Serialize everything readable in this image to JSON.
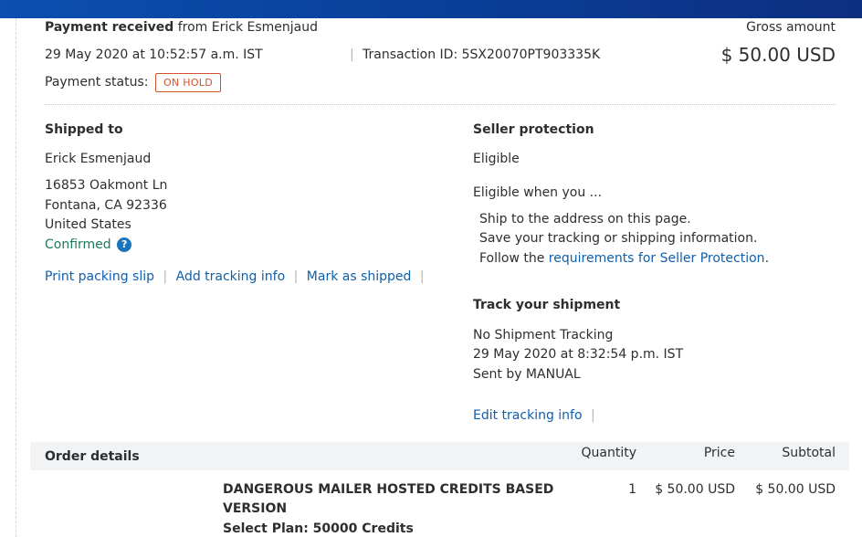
{
  "header": {
    "payment_received_label": "Payment received",
    "from_text": "from Erick Esmenjaud",
    "date_time": "29 May 2020 at 10:52:57 a.m. IST",
    "separator": "|",
    "transaction_id": "Transaction ID: 5SX20070PT903335K",
    "status_label": "Payment status:",
    "status_badge": "ON HOLD",
    "gross_amount_label": "Gross amount",
    "gross_amount": "$ 50.00 USD",
    "colors": {
      "top_bar": "#0b4fb0",
      "badge": "#d2532b",
      "link": "#0e5fac",
      "confirmed": "#1f7a5a"
    }
  },
  "shipping": {
    "heading": "Shipped to",
    "name": "Erick Esmenjaud",
    "address_line1": "16853 Oakmont Ln",
    "address_line2": "Fontana, CA 92336",
    "country": "United States",
    "confirmed": "Confirmed",
    "help_icon": "question-circle-icon",
    "help_glyph": "?",
    "actions": {
      "print_packing_slip": "Print packing slip",
      "add_tracking_info": "Add tracking info",
      "mark_as_shipped": "Mark as shipped",
      "separator": "|"
    }
  },
  "seller_protection": {
    "heading": "Seller protection",
    "status": "Eligible",
    "eligible_when": "Eligible when you ...",
    "item1": "Ship to the address on this page.",
    "item2": "Save your tracking or shipping information.",
    "item3_prefix": "Follow the",
    "item3_link": "requirements for Seller Protection",
    "item3_suffix": "."
  },
  "tracking": {
    "heading": "Track your shipment",
    "line1": "No Shipment Tracking",
    "line2": "29 May 2020 at 8:32:54 p.m. IST",
    "line3": "Sent by MANUAL",
    "edit_link": "Edit tracking info",
    "separator": "|"
  },
  "order": {
    "heading": "Order details",
    "columns": {
      "quantity": "Quantity",
      "price": "Price",
      "subtotal": "Subtotal"
    },
    "items": [
      {
        "name_line1": "DANGEROUS MAILER HOSTED CREDITS BASED",
        "name_line2": "VERSION",
        "plan": "Select Plan: 50000 Credits",
        "quantity": "1",
        "price": "$ 50.00 USD",
        "subtotal": "$ 50.00 USD"
      }
    ]
  }
}
